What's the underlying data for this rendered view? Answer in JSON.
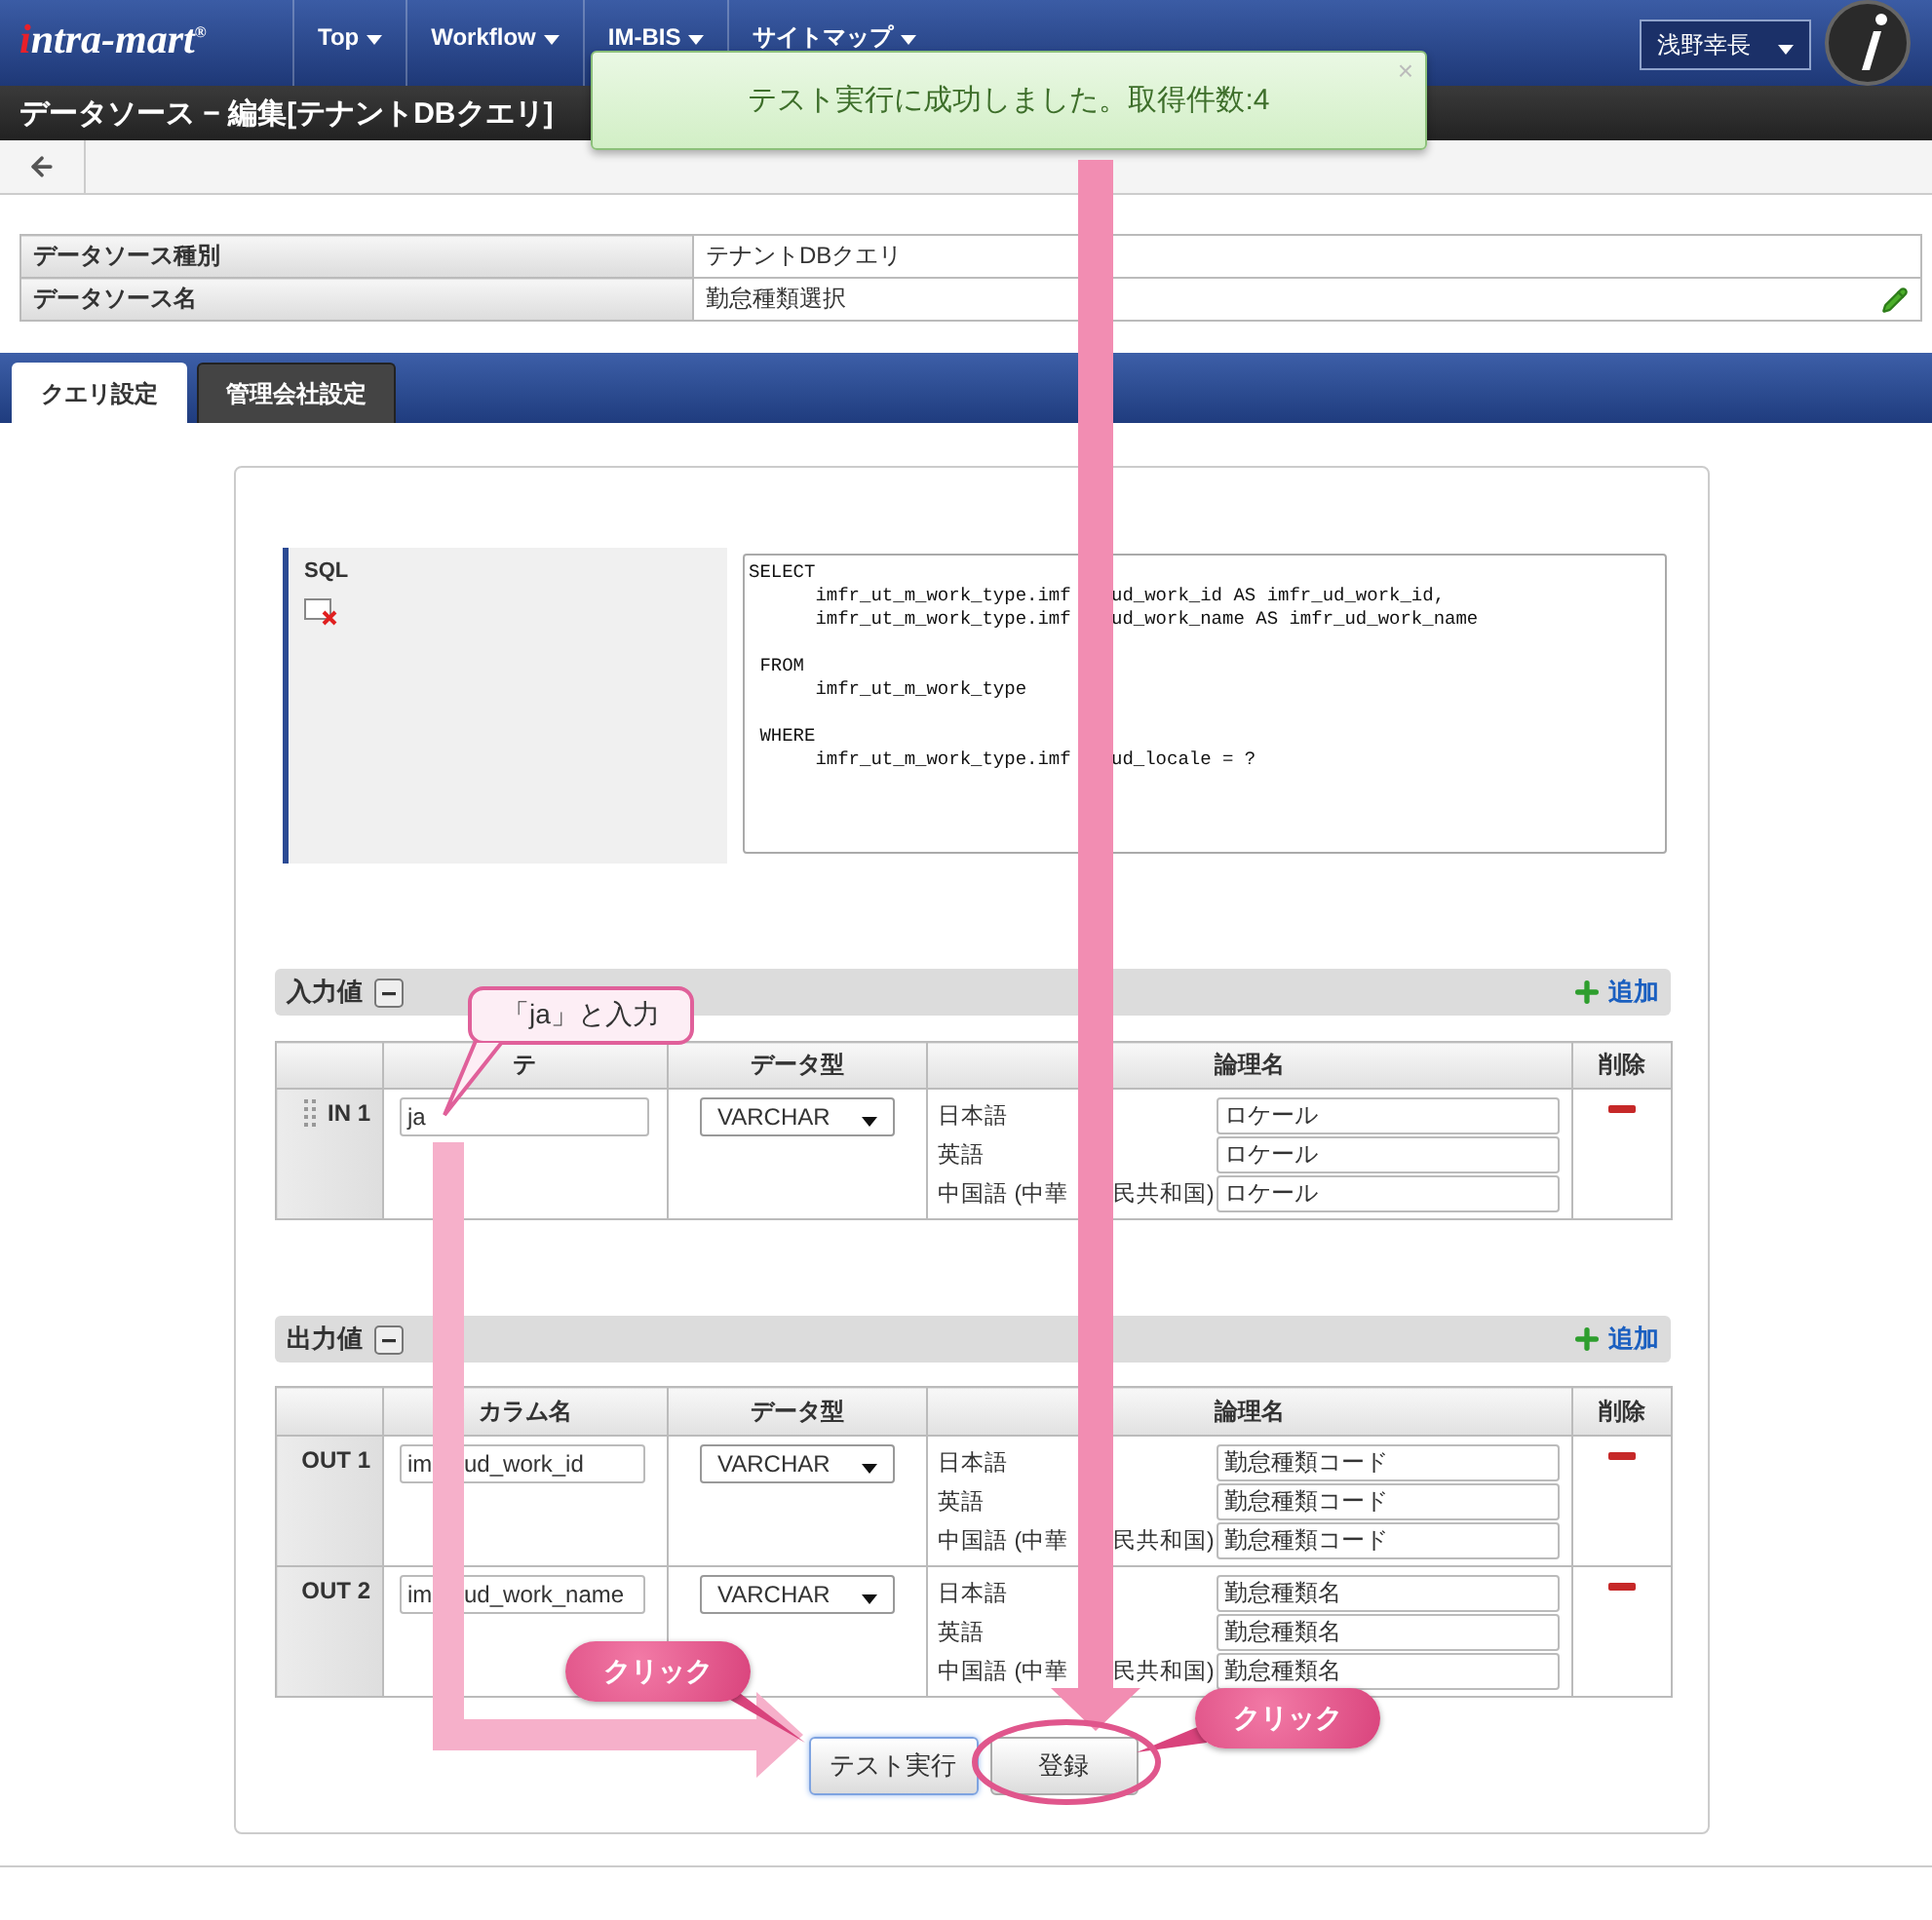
{
  "header": {
    "logo": "intra-mart$^{®}$",
    "nav": [
      {
        "label": "Top"
      },
      {
        "label": "Workflow"
      },
      {
        "label": "IM-BIS"
      },
      {
        "label": "サイトマップ"
      }
    ],
    "user": "浅野幸長"
  },
  "page_title": "データソース − 編集[テナントDBクエリ]",
  "toast": {
    "message": "テスト実行に成功しました。取得件数:4",
    "close": "×"
  },
  "info": [
    {
      "label": "データソース種別",
      "value": "テナントDBクエリ",
      "editable": false
    },
    {
      "label": "データソース名",
      "value": "勤怠種類選択",
      "editable": true
    }
  ],
  "tabs": [
    {
      "label": "クエリ設定",
      "selected": true
    },
    {
      "label": "管理会社設定",
      "selected": false
    }
  ],
  "sql": {
    "label": "SQL",
    "blocks": [
      [
        {
          "text": "SELECT"
        },
        {
          "text": "      imfr_ut_m_work_type.imf",
          "text_after": "ud_work_id AS imfr_ud_work_id,"
        },
        {
          "text": "      imfr_ut_m_work_type.imf",
          "text_after": "ud_work_name AS imfr_ud_work_name"
        }
      ],
      [
        {
          "text": " FROM"
        },
        {
          "text": "      imfr_ut_m_work_type"
        }
      ],
      [
        {
          "text": " WHERE"
        },
        {
          "text": "      imfr_ut_m_work_type.imf",
          "text_after": "ud_locale = ?"
        }
      ]
    ]
  },
  "input_values": {
    "title": "入力値",
    "add": "追加",
    "columns": [
      "テ",
      "データ型",
      "論理名",
      "削除"
    ],
    "rows": [
      {
        "key": "IN 1",
        "draggable": true,
        "column_name": "ja",
        "data_type": "VARCHAR",
        "names": [
          {
            "language": "日本語",
            "value": "ロケール"
          },
          {
            "language": "英語",
            "value": "ロケール"
          },
          {
            "language": "中国語 (中華",
            "language_after": "民共和国)",
            "value": "ロケール"
          }
        ]
      }
    ]
  },
  "output_values": {
    "title": "出力値",
    "add": "追加",
    "columns": [
      "カラム名",
      "データ型",
      "論理名",
      "削除"
    ],
    "rows": [
      {
        "key": "OUT 1",
        "draggable": false,
        "column_name": "im",
        "column_name_after": "ud_work_id",
        "data_type": "VARCHAR",
        "names": [
          {
            "language": "日本語",
            "value": "勤怠種類コード"
          },
          {
            "language": "英語",
            "value": "勤怠種類コード"
          },
          {
            "language": "中国語 (中華",
            "language_after": "民共和国)",
            "value": "勤怠種類コード"
          }
        ]
      },
      {
        "key": "OUT 2",
        "draggable": false,
        "column_name": "im",
        "column_name_after": "ud_work_name",
        "data_type": "VARCHAR",
        "names": [
          {
            "language": "日本語",
            "value": "勤怠種類名"
          },
          {
            "language": "英語",
            "value": "勤怠種類名"
          },
          {
            "language": "中国語 (中華",
            "language_after": "民共和国)",
            "value": "勤怠種類名"
          }
        ]
      }
    ]
  },
  "buttons": [
    {
      "label": "テスト実行",
      "focused": true
    },
    {
      "label": "登録",
      "focused": false
    }
  ],
  "annotations": {
    "callout": "「ja」と入力",
    "clicks": [
      "クリック",
      "クリック"
    ]
  }
}
